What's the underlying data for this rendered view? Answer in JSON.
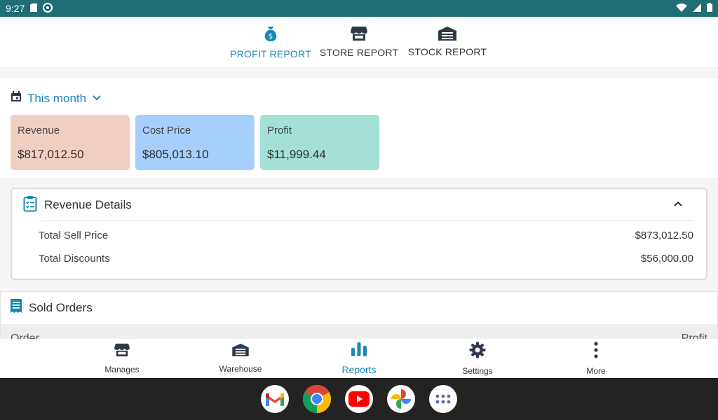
{
  "status_bar": {
    "time": "9:27"
  },
  "top_tabs": [
    {
      "label": "PROFIT REPORT",
      "active": true
    },
    {
      "label": "STORE REPORT",
      "active": false
    },
    {
      "label": "STOCK REPORT",
      "active": false
    }
  ],
  "summary": {
    "period": "This month",
    "cards": [
      {
        "title": "Revenue",
        "value": "$817,012.50",
        "color": "#f0cfc3"
      },
      {
        "title": "Cost Price",
        "value": "$805,013.10",
        "color": "#a6cffb"
      },
      {
        "title": "Profit",
        "value": "$11,999.44",
        "color": "#a3e1d7"
      }
    ]
  },
  "revenue_details": {
    "title": "Revenue Details",
    "rows": [
      {
        "label": "Total Sell Price",
        "value": "$873,012.50"
      },
      {
        "label": "Total Discounts",
        "value": "$56,000.00"
      }
    ]
  },
  "sold_orders": {
    "title": "Sold Orders",
    "columns": {
      "left": "Order",
      "right": "Profit"
    }
  },
  "bottom_nav": [
    {
      "label": "Manages",
      "icon": "store-icon",
      "active": false
    },
    {
      "label": "Warehouse",
      "icon": "warehouse-icon",
      "active": false
    },
    {
      "label": "Reports",
      "icon": "bar-chart-icon",
      "active": true
    },
    {
      "label": "Settings",
      "icon": "gear-icon",
      "active": false
    },
    {
      "label": "More",
      "icon": "more-vertical-icon",
      "active": false
    }
  ],
  "colors": {
    "accent": "#1a86b8",
    "status_bar": "#1f6e74",
    "dock": "#232323"
  },
  "dock_apps": [
    "gmail-icon",
    "chrome-icon",
    "youtube-icon",
    "photos-icon",
    "app-drawer-icon"
  ]
}
